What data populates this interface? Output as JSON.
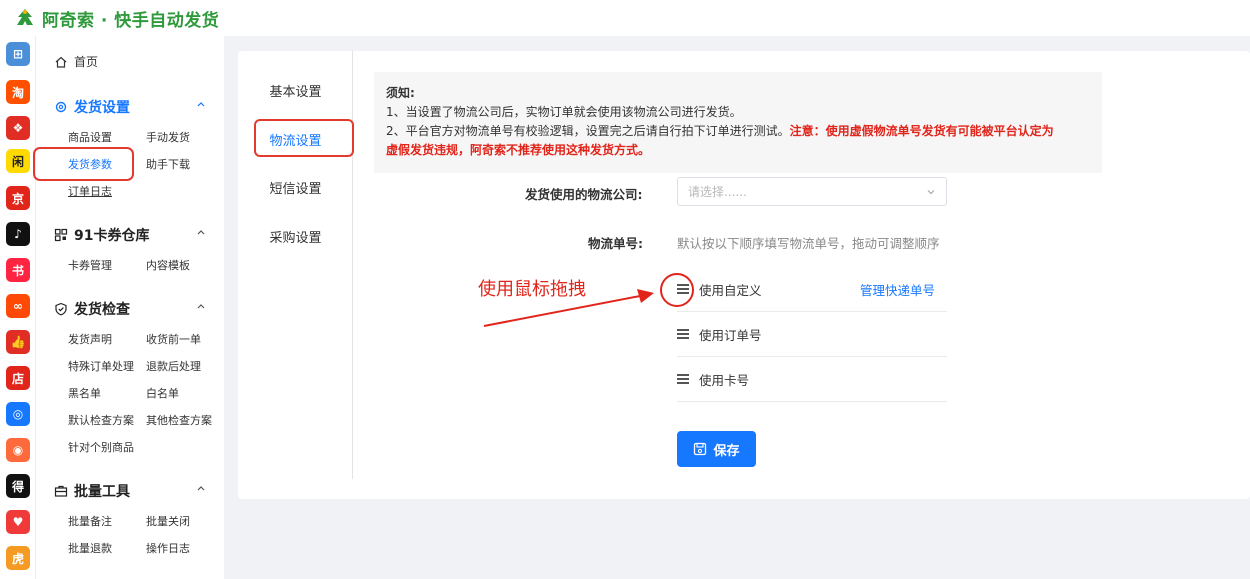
{
  "app": {
    "title": "阿奇索 · 快手自动发货"
  },
  "rail": {
    "items": [
      {
        "name": "apps-grid-icon",
        "glyph": "⊞",
        "color": "#4a8fd8"
      },
      {
        "name": "taobao-icon",
        "glyph": "淘",
        "color": "#ff5000"
      },
      {
        "name": "pinduoduo-icon",
        "glyph": "❖",
        "color": "#e02e24"
      },
      {
        "name": "goofish-icon",
        "glyph": "闲",
        "color": "#ffda00"
      },
      {
        "name": "jd-icon",
        "glyph": "京",
        "color": "#e1251b"
      },
      {
        "name": "douyin-icon",
        "glyph": "♪",
        "color": "#111111"
      },
      {
        "name": "xiaohongshu-icon",
        "glyph": "书",
        "color": "#ff2442"
      },
      {
        "name": "kuaishou-icon",
        "glyph": "∞",
        "color": "#ff4906"
      },
      {
        "name": "thumb-icon",
        "glyph": "👍",
        "color": "#e02e24"
      },
      {
        "name": "store-icon",
        "glyph": "店",
        "color": "#e1251b"
      },
      {
        "name": "link-icon",
        "glyph": "◎",
        "color": "#1677ff"
      },
      {
        "name": "shop-icon",
        "glyph": "◉",
        "color": "#ff6a3d"
      },
      {
        "name": "dewu-icon",
        "glyph": "得",
        "color": "#111111"
      },
      {
        "name": "heart-shield-icon",
        "glyph": "♥",
        "color": "#f03a3a"
      },
      {
        "name": "tiger-icon",
        "glyph": "虎",
        "color": "#f59a23"
      }
    ]
  },
  "nav": {
    "home": "首页",
    "groups": [
      {
        "title": "发货设置",
        "items": [
          "商品设置",
          "手动发货",
          "发货参数",
          "助手下载",
          "订单日志"
        ]
      },
      {
        "title": "91卡券仓库",
        "items": [
          "卡券管理",
          "内容模板"
        ]
      },
      {
        "title": "发货检查",
        "items": [
          "发货声明",
          "收货前一单",
          "特殊订单处理",
          "退款后处理",
          "黑名单",
          "白名单",
          "默认检查方案",
          "其他检查方案",
          "针对个别商品"
        ]
      },
      {
        "title": "批量工具",
        "items": [
          "批量备注",
          "批量关闭",
          "批量退款",
          "操作日志"
        ]
      }
    ]
  },
  "tabs": [
    "基本设置",
    "物流设置",
    "短信设置",
    "采购设置"
  ],
  "notice": {
    "title": "须知:",
    "line1": "1、当设置了物流公司后，实物订单就会使用该物流公司进行发货。",
    "line2_normal": "2、平台官方对物流单号有校验逻辑，设置完之后请自行拍下订单进行测试。",
    "line2_warn": "注意：使用虚假物流单号发货有可能被平台认定为",
    "line3_warn": "虚假发货违规，阿奇索不推荐使用这种发货方式。"
  },
  "form": {
    "company_label": "发货使用的物流公司:",
    "company_placeholder": "请选择......",
    "tracking_label": "物流单号:",
    "tracking_hint": "默认按以下顺序填写物流单号，拖动可调整顺序",
    "rows": [
      "使用自定义",
      "使用订单号",
      "使用卡号"
    ],
    "manage_link": "管理快递单号",
    "save": "保存"
  },
  "annotation": {
    "text": "使用鼠标拖拽"
  },
  "colors": {
    "accent": "#1677ff",
    "brand": "#2e9a3c",
    "warn": "#e1251b"
  }
}
